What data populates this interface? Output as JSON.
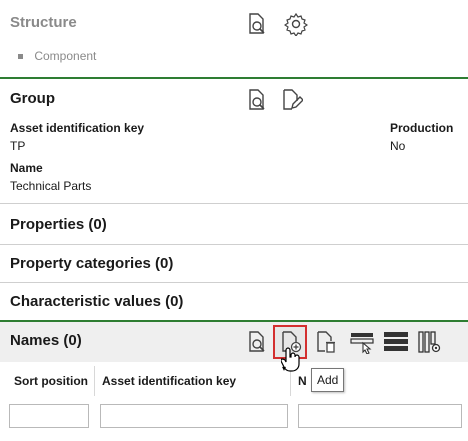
{
  "structure": {
    "title": "Structure",
    "items": [
      "Component"
    ]
  },
  "group": {
    "title": "Group",
    "fields": [
      {
        "label": "Asset identification key",
        "value": "TP"
      },
      {
        "label": "Production",
        "value": "No"
      },
      {
        "label": "Name",
        "value": "Technical Parts"
      }
    ]
  },
  "sections": {
    "properties": "Properties (0)",
    "property_categories": "Property categories (0)",
    "characteristic_values": "Characteristic values (0)"
  },
  "names": {
    "title": "Names (0)",
    "tooltip": "Add",
    "columns": [
      "Sort position",
      "Asset identification key",
      "N"
    ]
  },
  "colors": {
    "accent_green": "#2e7d32",
    "highlight_red": "#d32f2f",
    "dark_icon": "#333333"
  }
}
